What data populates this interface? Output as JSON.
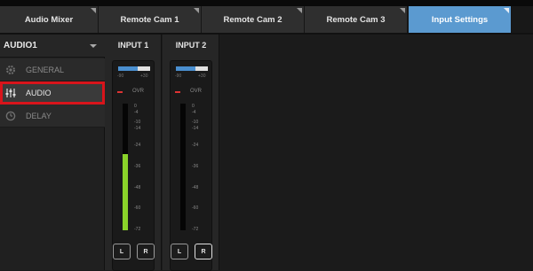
{
  "tabs": [
    {
      "label": "Audio Mixer"
    },
    {
      "label": "Remote Cam 1"
    },
    {
      "label": "Remote Cam 2"
    },
    {
      "label": "Remote Cam 3"
    },
    {
      "label": "Input Settings",
      "active": true
    }
  ],
  "sidebar": {
    "dropdown": {
      "value": "AUDIO1"
    },
    "items": [
      {
        "label": "GENERAL",
        "icon": "gear-icon"
      },
      {
        "label": "AUDIO",
        "icon": "sliders-icon",
        "selected": true
      },
      {
        "label": "DELAY",
        "icon": "clock-icon"
      }
    ]
  },
  "channels": [
    {
      "label": "INPUT 1",
      "range_min": "-90",
      "range_max": "+30",
      "ovr": "OVR",
      "scale": [
        "0",
        "-4",
        "-10",
        "-14",
        "-24",
        "-36",
        "-48",
        "-60",
        "-72"
      ],
      "level_fraction": 0.6,
      "gain_fraction": 0.6,
      "left_button": "L",
      "right_button": "R"
    },
    {
      "label": "INPUT 2",
      "range_min": "-90",
      "range_max": "+30",
      "ovr": "OVR",
      "scale": [
        "0",
        "-4",
        "-10",
        "-14",
        "-24",
        "-36",
        "-48",
        "-60",
        "-72"
      ],
      "level_fraction": 0.0,
      "gain_fraction": 0.6,
      "left_button": "L",
      "right_button": "R"
    }
  ],
  "colors": {
    "active_tab": "#5b9ad0",
    "meter_fill": "#8ad32a",
    "gain_bar": "#4a8fcf",
    "selection_outline": "#d8141b"
  }
}
